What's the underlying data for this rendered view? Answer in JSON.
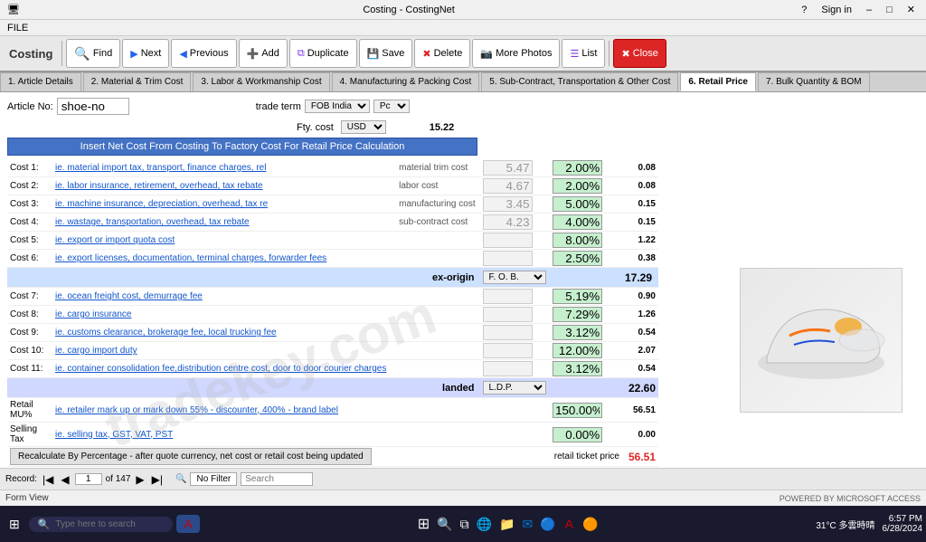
{
  "window": {
    "title": "Costing - CostingNet",
    "help": "?",
    "sign_in": "Sign in",
    "minimize": "–",
    "maximize": "□",
    "close": "✕"
  },
  "menu": [
    "FILE"
  ],
  "toolbar": {
    "costing_label": "Costing",
    "find_label": "Find",
    "next_label": "Next",
    "prev_label": "Previous",
    "add_label": "Add",
    "dup_label": "Duplicate",
    "save_label": "Save",
    "del_label": "Delete",
    "more_label": "More Photos",
    "list_label": "List",
    "close_label": "Close"
  },
  "tabs": [
    {
      "label": "1. Article Details"
    },
    {
      "label": "2. Material & Trim Cost"
    },
    {
      "label": "3. Labor & Workmanship Cost"
    },
    {
      "label": "4. Manufacturing & Packing Cost"
    },
    {
      "label": "5. Sub-Contract, Transportation & Other Cost"
    },
    {
      "label": "6. Retail Price",
      "active": true
    },
    {
      "label": "7. Bulk Quantity & BOM"
    }
  ],
  "article": {
    "no_label": "Article No:",
    "no_value": "shoe-no",
    "trade_term_label": "trade term",
    "trade_term_value": "FOB India",
    "pc_value": "Pc",
    "fty_cost_label": "Fty. cost",
    "currency_value": "USD",
    "fty_cost_value": "15.22"
  },
  "banner": "Insert Net Cost From Costing To Factory Cost For Retail Price Calculation",
  "costs": [
    {
      "label": "Cost 1:",
      "desc": "ie. material import tax, transport, finance charges, rel",
      "type": "material trim cost",
      "num": "5.47",
      "pct": "2.00%",
      "val": "0.08"
    },
    {
      "label": "Cost 2:",
      "desc": "ie. labor insurance, retirement, overhead, tax rebate",
      "type": "labor cost",
      "num": "4.67",
      "pct": "2.00%",
      "val": "0.08"
    },
    {
      "label": "Cost 3:",
      "desc": "ie. machine insurance, depreciation, overhead, tax re",
      "type": "manufacturing cost",
      "num": "3.45",
      "pct": "5.00%",
      "val": "0.15"
    },
    {
      "label": "Cost 4:",
      "desc": "ie. wastage, transportation, overhead, tax rebate",
      "type": "sub-contract cost",
      "num": "4.23",
      "pct": "4.00%",
      "val": "0.15"
    },
    {
      "label": "Cost 5:",
      "desc": "ie. export or import quota cost",
      "type": "",
      "num": "",
      "pct": "8.00%",
      "val": "1.22"
    },
    {
      "label": "Cost 6:",
      "desc": "ie. export licenses, documentation, terminal charges, forwarder fees",
      "type": "",
      "num": "",
      "pct": "2.50%",
      "val": "0.38"
    }
  ],
  "exorigin": {
    "label": "ex-origin",
    "fob_value": "F. O. B.",
    "value": "17.29"
  },
  "logistics_costs": [
    {
      "label": "Cost 7:",
      "desc": "ie. ocean freight cost, demurrage fee",
      "num": "",
      "pct": "5.19%",
      "val": "0.90"
    },
    {
      "label": "Cost 8:",
      "desc": "ie. cargo insurance",
      "num": "",
      "pct": "7.29%",
      "val": "1.26"
    },
    {
      "label": "Cost 9:",
      "desc": "ie. customs clearance, brokerage fee, local trucking fee",
      "num": "",
      "pct": "3.12%",
      "val": "0.54"
    },
    {
      "label": "Cost 10:",
      "desc": "ie. cargo import duty",
      "num": "",
      "pct": "12.00%",
      "val": "2.07"
    },
    {
      "label": "Cost 11:",
      "desc": "ie. container consolidation fee,distribution centre cost, door to door courier charges",
      "num": "",
      "pct": "3.12%",
      "val": "0.54"
    }
  ],
  "landed": {
    "label": "landed",
    "type_value": "L.D.P.",
    "value": "22.60"
  },
  "retail": {
    "mu_label": "Retail MU%",
    "mu_desc": "ie. retailer mark up or mark down  55% - discounter, 400% - brand label",
    "mu_pct": "150.00%",
    "mu_val": "56.51",
    "tax_label": "Selling Tax",
    "tax_desc": "ie. selling tax, GST, VAT, PST",
    "tax_pct": "0.00%",
    "tax_val": "0.00",
    "ticket_label": "retail ticket price",
    "ticket_val": "56.51"
  },
  "recalc_btn": "Recalculate By Percentage - after quote currency, net cost or retail cost being updated",
  "record_nav": {
    "record_label": "Record: ",
    "current": "1",
    "total": "of 147",
    "no_filter": "No Filter",
    "search_placeholder": "Search"
  },
  "status_bar": "Form View",
  "taskbar": {
    "search_placeholder": "Type here to search",
    "time": "6:57 PM",
    "date": "6/28/2024",
    "weather": "31°C 多雲時晴",
    "powered": "POWERED BY MICROSOFT ACCESS"
  }
}
